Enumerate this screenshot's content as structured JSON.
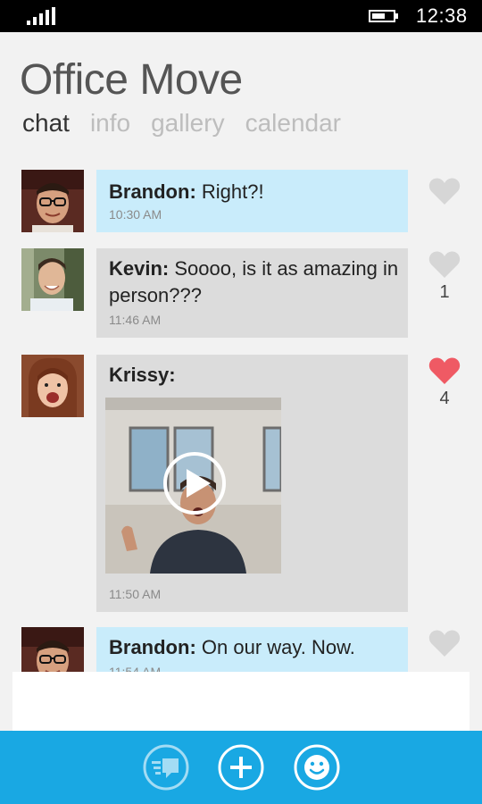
{
  "status_bar": {
    "time": "12:38",
    "icons": [
      "signal-icon",
      "battery-icon"
    ]
  },
  "header": {
    "title": "Office Move"
  },
  "pivot": {
    "tabs": [
      "chat",
      "info",
      "gallery",
      "calendar"
    ],
    "active": "chat"
  },
  "messages": [
    {
      "sender": "Brandon:",
      "text": "Right?!",
      "time": "10:30 AM",
      "liked": false,
      "likes": ""
    },
    {
      "sender": "Kevin:",
      "text": "Soooo, is it as amazing in person???",
      "time": "11:46 AM",
      "liked": false,
      "likes": "1"
    },
    {
      "sender": "Krissy:",
      "text": "",
      "time": "11:50 AM",
      "liked": true,
      "likes": "4",
      "attachment": "video"
    },
    {
      "sender": "Brandon:",
      "text": "On our way. Now.",
      "time": "11:54 AM",
      "liked": false,
      "likes": ""
    }
  ],
  "app_bar": {
    "buttons": [
      "messages-icon",
      "add-icon",
      "emoticon-icon"
    ]
  },
  "colors": {
    "accent": "#19a8e3",
    "bubble_blue": "#c9ecfb",
    "bubble_grey": "#dcdcdc",
    "heart_liked": "#ef5a64",
    "heart_default": "#d6d6d6"
  }
}
